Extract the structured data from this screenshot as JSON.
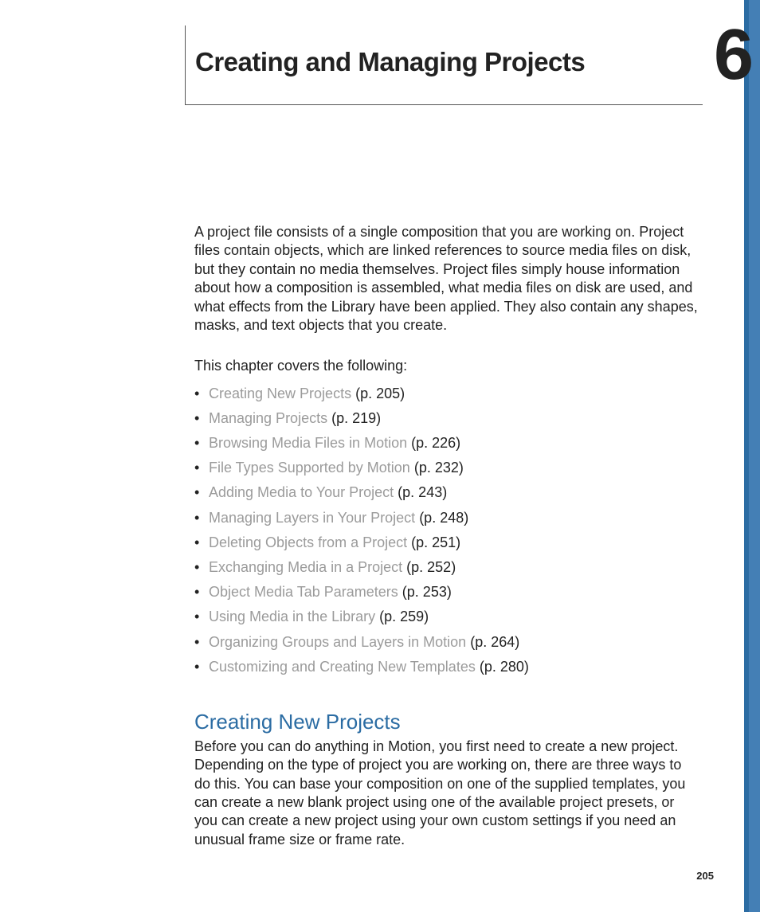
{
  "chapter": {
    "title": "Creating and Managing Projects",
    "number": "6"
  },
  "intro": "A project file consists of a single composition that you are working on. Project files contain objects, which are linked references to source media files on disk, but they contain no media themselves. Project files simply house information about how a composition is assembled, what media files on disk are used, and what effects from the Library have been applied. They also contain any shapes, masks, and text objects that you create.",
  "covers_line": "This chapter covers the following:",
  "toc": [
    {
      "label": "Creating New Projects",
      "page": "(p. 205)"
    },
    {
      "label": "Managing Projects",
      "page": "(p. 219)"
    },
    {
      "label": "Browsing Media Files in Motion",
      "page": "(p. 226)"
    },
    {
      "label": "File Types Supported by Motion",
      "page": "(p. 232)"
    },
    {
      "label": "Adding Media to Your Project",
      "page": "(p. 243)"
    },
    {
      "label": "Managing Layers in Your Project",
      "page": "(p. 248)"
    },
    {
      "label": "Deleting Objects from a Project",
      "page": "(p. 251)"
    },
    {
      "label": "Exchanging Media in a Project",
      "page": "(p. 252)"
    },
    {
      "label": "Object Media Tab Parameters",
      "page": "(p. 253)"
    },
    {
      "label": "Using Media in the Library",
      "page": "(p. 259)"
    },
    {
      "label": "Organizing Groups and Layers in Motion",
      "page": "(p. 264)"
    },
    {
      "label": "Customizing and Creating New Templates",
      "page": "(p. 280)"
    }
  ],
  "section": {
    "heading": "Creating New Projects",
    "body": "Before you can do anything in Motion, you first need to create a new project. Depending on the type of project you are working on, there are three ways to do this. You can base your composition on one of the supplied templates, you can create a new blank project using one of the available project presets, or you can create a new project using your own custom settings if you need an unusual frame size or frame rate."
  },
  "page_number": "205"
}
